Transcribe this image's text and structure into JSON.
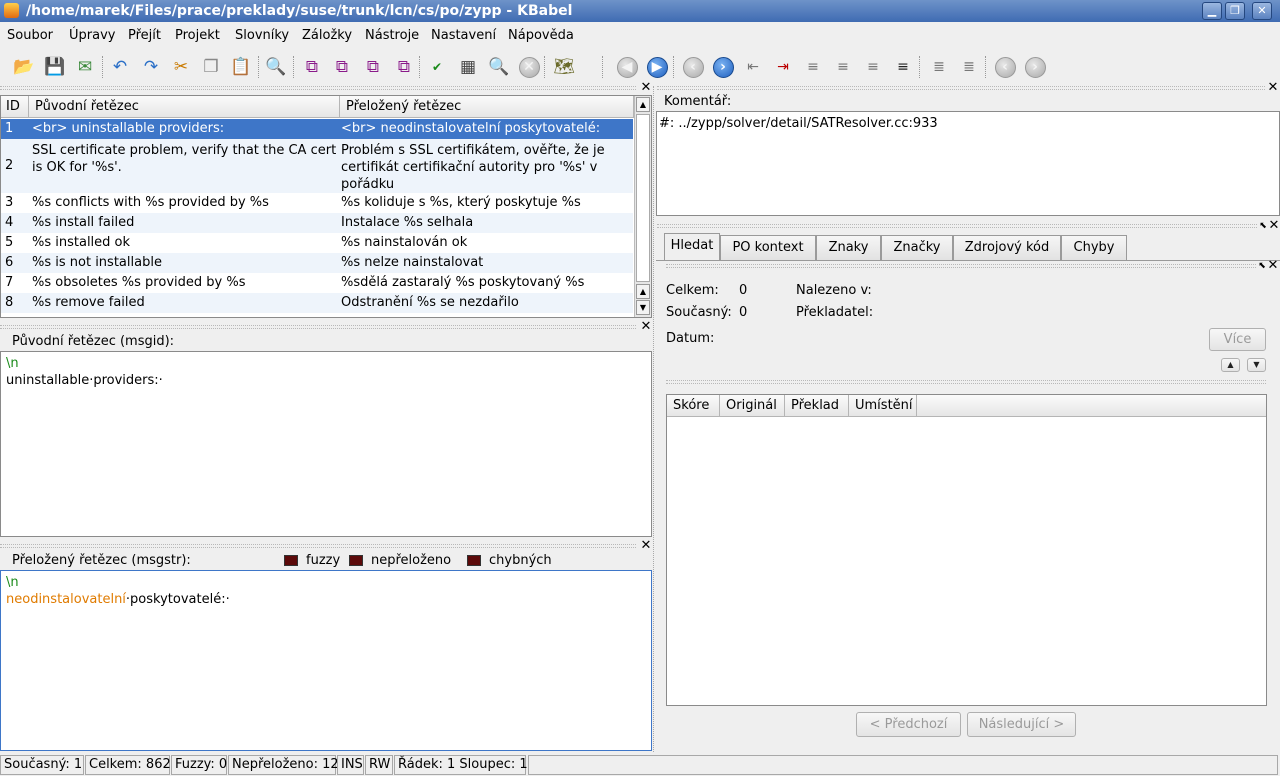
{
  "window": {
    "title": "/home/marek/Files/prace/preklady/suse/trunk/lcn/cs/po/zypp - KBabel"
  },
  "menu": [
    "Soubor",
    "Úpravy",
    "Přejít",
    "Projekt",
    "Slovníky",
    "Záložky",
    "Nástroje",
    "Nastavení",
    "Nápověda"
  ],
  "table": {
    "headers": {
      "id": "ID",
      "original": "Původní řetězec",
      "translated": "Přeložený řetězec"
    },
    "rows": [
      {
        "id": "1",
        "original": "<br> uninstallable providers:",
        "translated": "<br> neodinstalovatelní poskytovatelé:"
      },
      {
        "id": "2",
        "original": "SSL certificate problem, verify that the CA cert is OK for '%s'.",
        "translated": "Problém s SSL certifikátem, ověřte, že je certifikát certifikační autority pro '%s' v pořádku"
      },
      {
        "id": "3",
        "original": "%s conflicts with %s provided by %s",
        "translated": "%s koliduje s %s, který poskytuje %s"
      },
      {
        "id": "4",
        "original": "%s install failed",
        "translated": "Instalace %s selhala"
      },
      {
        "id": "5",
        "original": "%s installed ok",
        "translated": "%s nainstalován ok"
      },
      {
        "id": "6",
        "original": "%s is not installable",
        "translated": "%s nelze nainstalovat"
      },
      {
        "id": "7",
        "original": "%s obsoletes %s provided by %s",
        "translated": "%sdělá zastaralý %s poskytovaný %s"
      },
      {
        "id": "8",
        "original": "%s remove failed",
        "translated": "Odstranění %s se nezdařilo"
      }
    ]
  },
  "msgid": {
    "label": "Původní řetězec (msgid):",
    "line1": "\\n",
    "line2": "uninstallable·providers:·"
  },
  "msgstr": {
    "label": "Přeložený řetězec (msgstr):",
    "flags": [
      "fuzzy",
      "nepřeloženo",
      "chybných"
    ],
    "line1": "\\n",
    "word1": "neodinstalovatelní",
    "rest": "·poskytovatelé:·"
  },
  "comment": {
    "label": "Komentář:",
    "text": "#: ../zypp/solver/detail/SATResolver.cc:933"
  },
  "tabs": [
    "Hledat",
    "PO kontext",
    "Znaky",
    "Značky",
    "Zdrojový kód",
    "Chyby"
  ],
  "search": {
    "total_label": "Celkem:",
    "total_value": "0",
    "current_label": "Současný:",
    "current_value": "0",
    "found_label": "Nalezeno v:",
    "translator_label": "Překladatel:",
    "date_label": "Datum:",
    "more_button": "Více",
    "columns": [
      "Skóre",
      "Originál",
      "Překlad",
      "Umístění"
    ],
    "prev_button": "< Předchozí",
    "next_button": "Následující >"
  },
  "status": [
    "Současný: 1",
    "Celkem: 862",
    "Fuzzy: 0",
    "Nepřeloženo: 12",
    "INS",
    "RW",
    "Řádek: 1 Sloupec: 1"
  ],
  "colors": {
    "selection": "#3e76c8",
    "titlebar": "#4f78bb",
    "orange_text": "#e07b00",
    "green_text": "#1a8a1a"
  }
}
